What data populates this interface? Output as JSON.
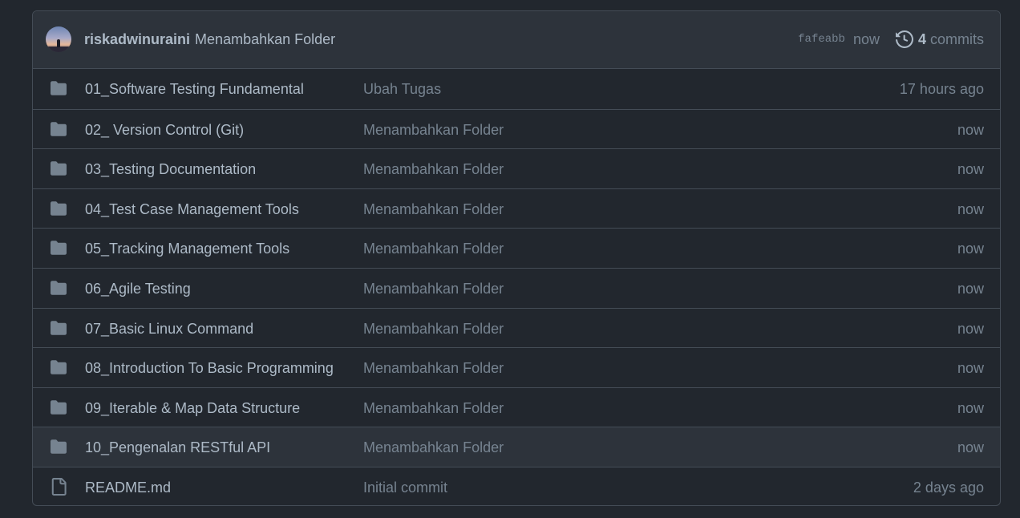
{
  "latest_commit": {
    "author": "riskadwinuraini",
    "message": "Menambahkan Folder",
    "sha": "fafeabb",
    "time": "now",
    "commits_count": "4",
    "commits_label": "commits"
  },
  "files": [
    {
      "type": "folder",
      "name": "01_Software Testing Fundamental",
      "commit": "Ubah Tugas",
      "age": "17 hours ago"
    },
    {
      "type": "folder",
      "name": "02_ Version Control (Git)",
      "commit": "Menambahkan Folder",
      "age": "now"
    },
    {
      "type": "folder",
      "name": "03_Testing Documentation",
      "commit": "Menambahkan Folder",
      "age": "now"
    },
    {
      "type": "folder",
      "name": "04_Test Case Management Tools",
      "commit": "Menambahkan Folder",
      "age": "now"
    },
    {
      "type": "folder",
      "name": "05_Tracking Management Tools",
      "commit": "Menambahkan Folder",
      "age": "now"
    },
    {
      "type": "folder",
      "name": "06_Agile Testing",
      "commit": "Menambahkan Folder",
      "age": "now"
    },
    {
      "type": "folder",
      "name": "07_Basic Linux Command",
      "commit": "Menambahkan Folder",
      "age": "now"
    },
    {
      "type": "folder",
      "name": "08_Introduction To Basic Programming",
      "commit": "Menambahkan Folder",
      "age": "now"
    },
    {
      "type": "folder",
      "name": "09_Iterable & Map Data Structure",
      "commit": "Menambahkan Folder",
      "age": "now"
    },
    {
      "type": "folder",
      "name": "10_Pengenalan RESTful API",
      "commit": "Menambahkan Folder",
      "age": "now"
    },
    {
      "type": "file",
      "name": "README.md",
      "commit": "Initial commit",
      "age": "2 days ago"
    }
  ],
  "colors": {
    "background": "#22272e",
    "header": "#2d333b",
    "border": "#444c56",
    "text": "#adbac7",
    "muted": "#768390",
    "icon": "#768390"
  },
  "icons": {
    "folder": "folder-icon",
    "file": "file-icon",
    "history": "history-icon"
  }
}
